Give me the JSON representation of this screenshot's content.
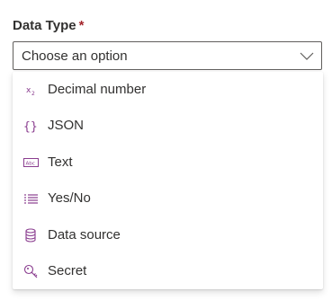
{
  "field": {
    "label": "Data Type",
    "required_mark": "*"
  },
  "dropdown": {
    "placeholder": "Choose an option",
    "icon": "chevron-down-icon"
  },
  "menu": {
    "items": [
      {
        "label": "Decimal number",
        "icon": "decimal-number-icon"
      },
      {
        "label": "JSON",
        "icon": "json-braces-icon"
      },
      {
        "label": "Text",
        "icon": "text-abc-icon"
      },
      {
        "label": "Yes/No",
        "icon": "list-icon"
      },
      {
        "label": "Data source",
        "icon": "database-icon"
      },
      {
        "label": "Secret",
        "icon": "key-icon"
      }
    ]
  },
  "colors": {
    "icon_accent": "#8a3d8f",
    "required": "#a4262c",
    "border": "#605e5c"
  }
}
